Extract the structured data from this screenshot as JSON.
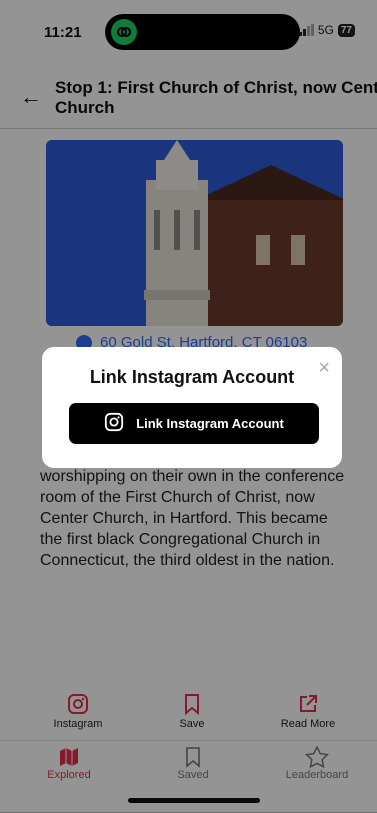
{
  "status": {
    "time": "11:21",
    "network": "5G",
    "battery": "77"
  },
  "header": {
    "title": "Stop 1: First Church of Christ, now Center Church"
  },
  "address": "60 Gold St, Hartford, CT 06103",
  "body_text": "worshipping on their own in the conference room of the First Church of Christ, now Center Church, in Hartford. This became the first black Congregational Church in Connecticut, the third oldest in the nation.",
  "actions": [
    {
      "label": "Instagram",
      "icon": "instagram-icon"
    },
    {
      "label": "Save",
      "icon": "bookmark-icon"
    },
    {
      "label": "Read More",
      "icon": "external-link-icon"
    }
  ],
  "tabs": [
    {
      "label": "Explored",
      "icon": "map-icon",
      "active": true
    },
    {
      "label": "Saved",
      "icon": "bookmark-icon",
      "active": false
    },
    {
      "label": "Leaderboard",
      "icon": "star-icon",
      "active": false
    }
  ],
  "modal": {
    "title": "Link Instagram Account",
    "button_label": "Link Instagram Account",
    "close": "×"
  },
  "colors": {
    "accent": "#e0314f",
    "link": "#2f6bff",
    "modal_button": "#000000"
  }
}
